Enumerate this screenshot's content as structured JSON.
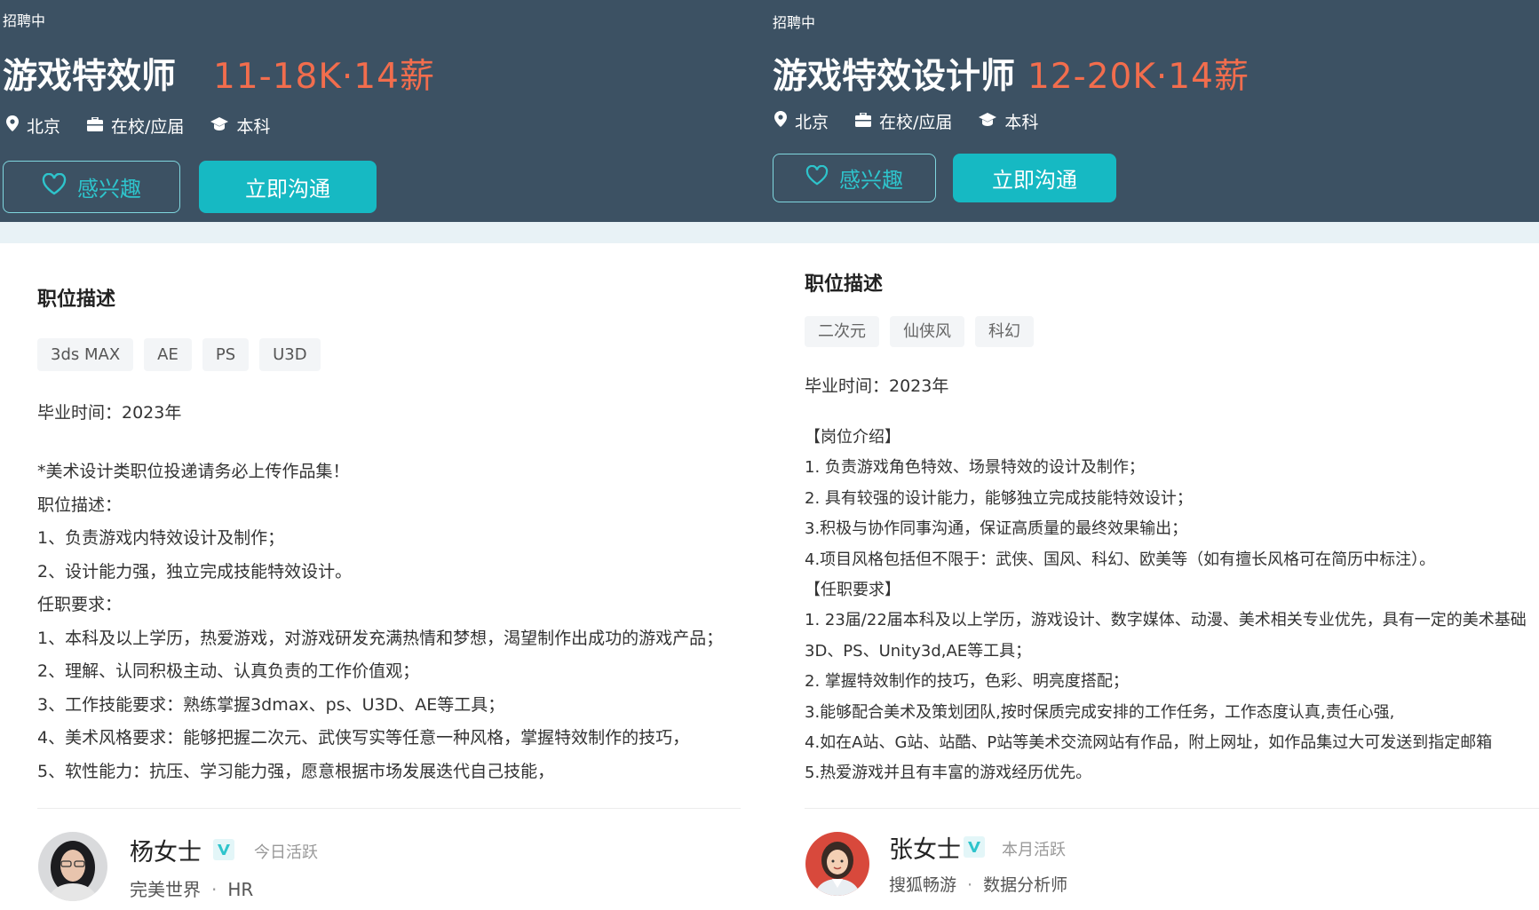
{
  "left": {
    "status": "招聘中",
    "title": "游戏特效师",
    "salary": "11-18K·14薪",
    "meta": {
      "location": "北京",
      "type": "在校/应届",
      "degree": "本科"
    },
    "buttons": {
      "interest": "感兴趣",
      "chat": "立即沟通"
    },
    "section_title": "职位描述",
    "tags": [
      "3ds MAX",
      "AE",
      "PS",
      "U3D"
    ],
    "graduation": "毕业时间：2023年",
    "description": [
      "*美术设计类职位投递请务必上传作品集！",
      "职位描述：",
      "1、负责游戏内特效设计及制作；",
      "2、设计能力强，独立完成技能特效设计。",
      "任职要求：",
      "1、本科及以上学历，热爱游戏，对游戏研发充满热情和梦想，渴望制作出成功的游戏产品；",
      "2、理解、认同积极主动、认真负责的工作价值观；",
      "3、工作技能要求：熟练掌握3dmax、ps、U3D、AE等工具；",
      "4、美术风格要求：能够把握二次元、武侠写实等任意一种风格，掌握特效制作的技巧，",
      "5、软性能力：抗压、学习能力强，愿意根据市场发展迭代自己技能，"
    ],
    "recruiter": {
      "name": "杨女士",
      "active": "今日活跃",
      "company": "完美世界",
      "role": "HR",
      "separator": "·"
    }
  },
  "right": {
    "status": "招聘中",
    "title": "游戏特效设计师",
    "salary": "12-20K·14薪",
    "meta": {
      "location": "北京",
      "type": "在校/应届",
      "degree": "本科"
    },
    "buttons": {
      "interest": "感兴趣",
      "chat": "立即沟通"
    },
    "section_title": "职位描述",
    "tags": [
      "二次元",
      "仙侠风",
      "科幻"
    ],
    "graduation": "毕业时间：2023年",
    "description": [
      "【岗位介绍】",
      "1. 负责游戏角色特效、场景特效的设计及制作；",
      "2. 具有较强的设计能力，能够独立完成技能特效设计；",
      "3.积极与协作同事沟通，保证高质量的最终效果输出；",
      "4.项目风格包括但不限于：武侠、国风、科幻、欧美等（如有擅长风格可在简历中标注）。",
      "【任职要求】",
      "1. 23届/22届本科及以上学历，游戏设计、数字媒体、动漫、美术相关专业优先，具有一定的美术基础",
      "3D、PS、Unity3d,AE等工具；",
      "2. 掌握特效制作的技巧，色彩、明亮度搭配；",
      "3.能够配合美术及策划团队,按时保质完成安排的工作任务，工作态度认真,责任心强,",
      "4.如在A站、G站、站酷、P站等美术交流网站有作品，附上网址，如作品集过大可发送到指定邮箱",
      "5.热爱游戏并且有丰富的游戏经历优先。"
    ],
    "recruiter": {
      "name": "张女士",
      "active": "本月活跃",
      "company": "搜狐畅游",
      "role": "数据分析师",
      "separator": "·"
    }
  },
  "colors": {
    "header_bg": "#3c5163",
    "accent": "#16b9c3",
    "salary": "#f26d4d",
    "strip": "#e8f2f6"
  },
  "icons": [
    "location-pin-icon",
    "briefcase-icon",
    "graduation-cap-icon",
    "heart-icon",
    "verified-badge-icon"
  ]
}
